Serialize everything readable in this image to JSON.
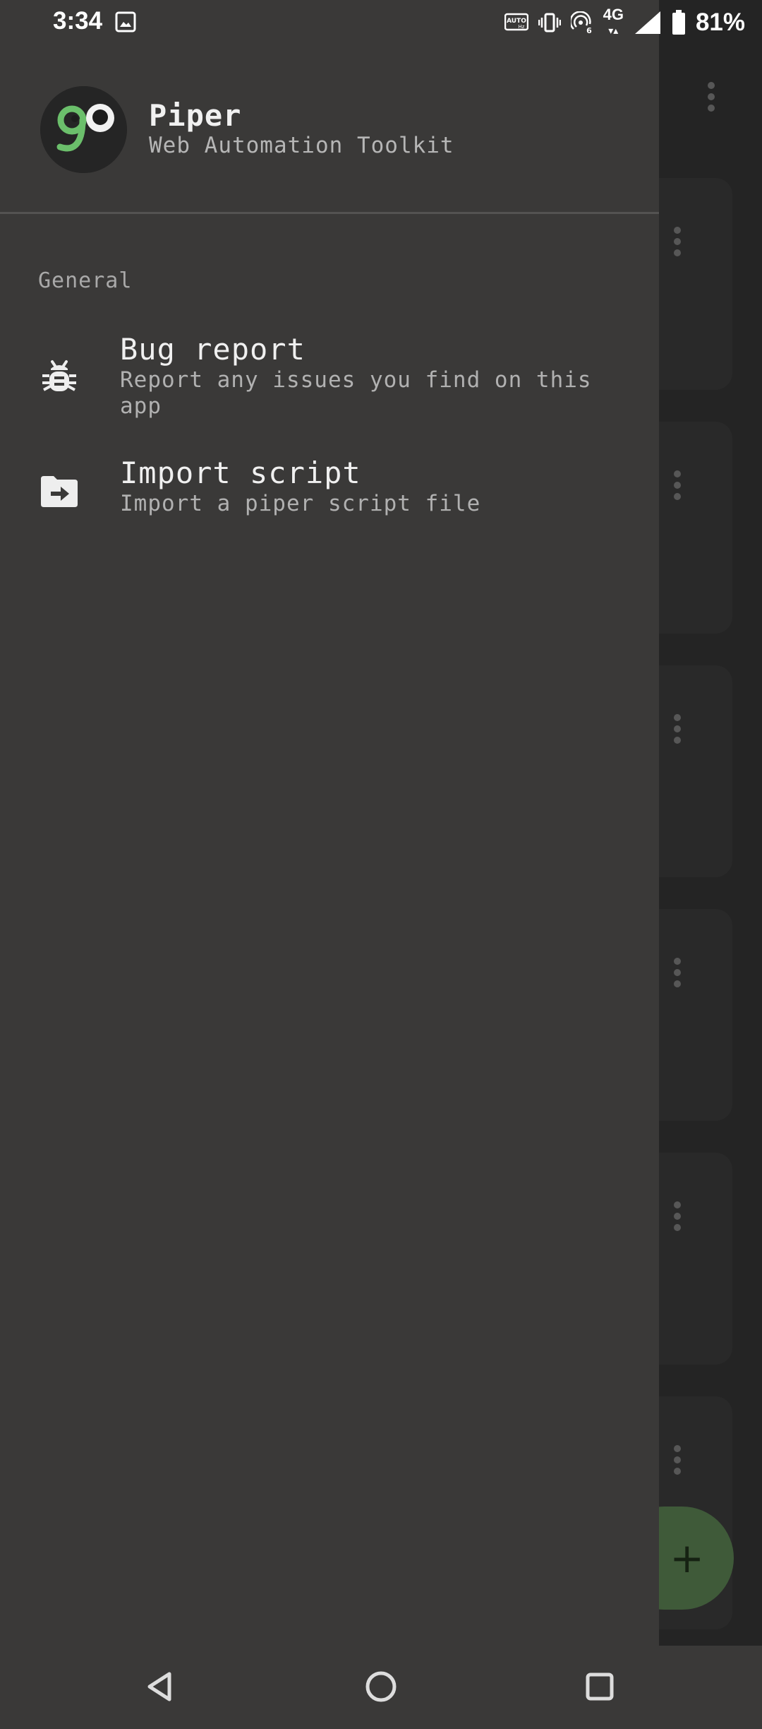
{
  "status_bar": {
    "time": "3:34",
    "battery": "81%",
    "network": "4G",
    "icons": [
      "image-icon",
      "auto-hz-icon",
      "vibrate-icon",
      "hotspot-icon",
      "signal-icon",
      "battery-icon"
    ]
  },
  "drawer": {
    "app_name": "Piper",
    "app_tagline": "Web Automation Toolkit",
    "section_label": "General",
    "items": [
      {
        "title": "Bug report",
        "subtitle": "Report any issues you find on this app",
        "icon": "bug-icon"
      },
      {
        "title": "Import script",
        "subtitle": "Import a piper script file",
        "icon": "folder-import-icon"
      }
    ]
  },
  "fab": {
    "icon": "plus-icon",
    "label": "+"
  },
  "colors": {
    "drawer_bg": "#3a3938",
    "fab_bg": "#4e6e46",
    "logo_green": "#6bbf6b"
  }
}
